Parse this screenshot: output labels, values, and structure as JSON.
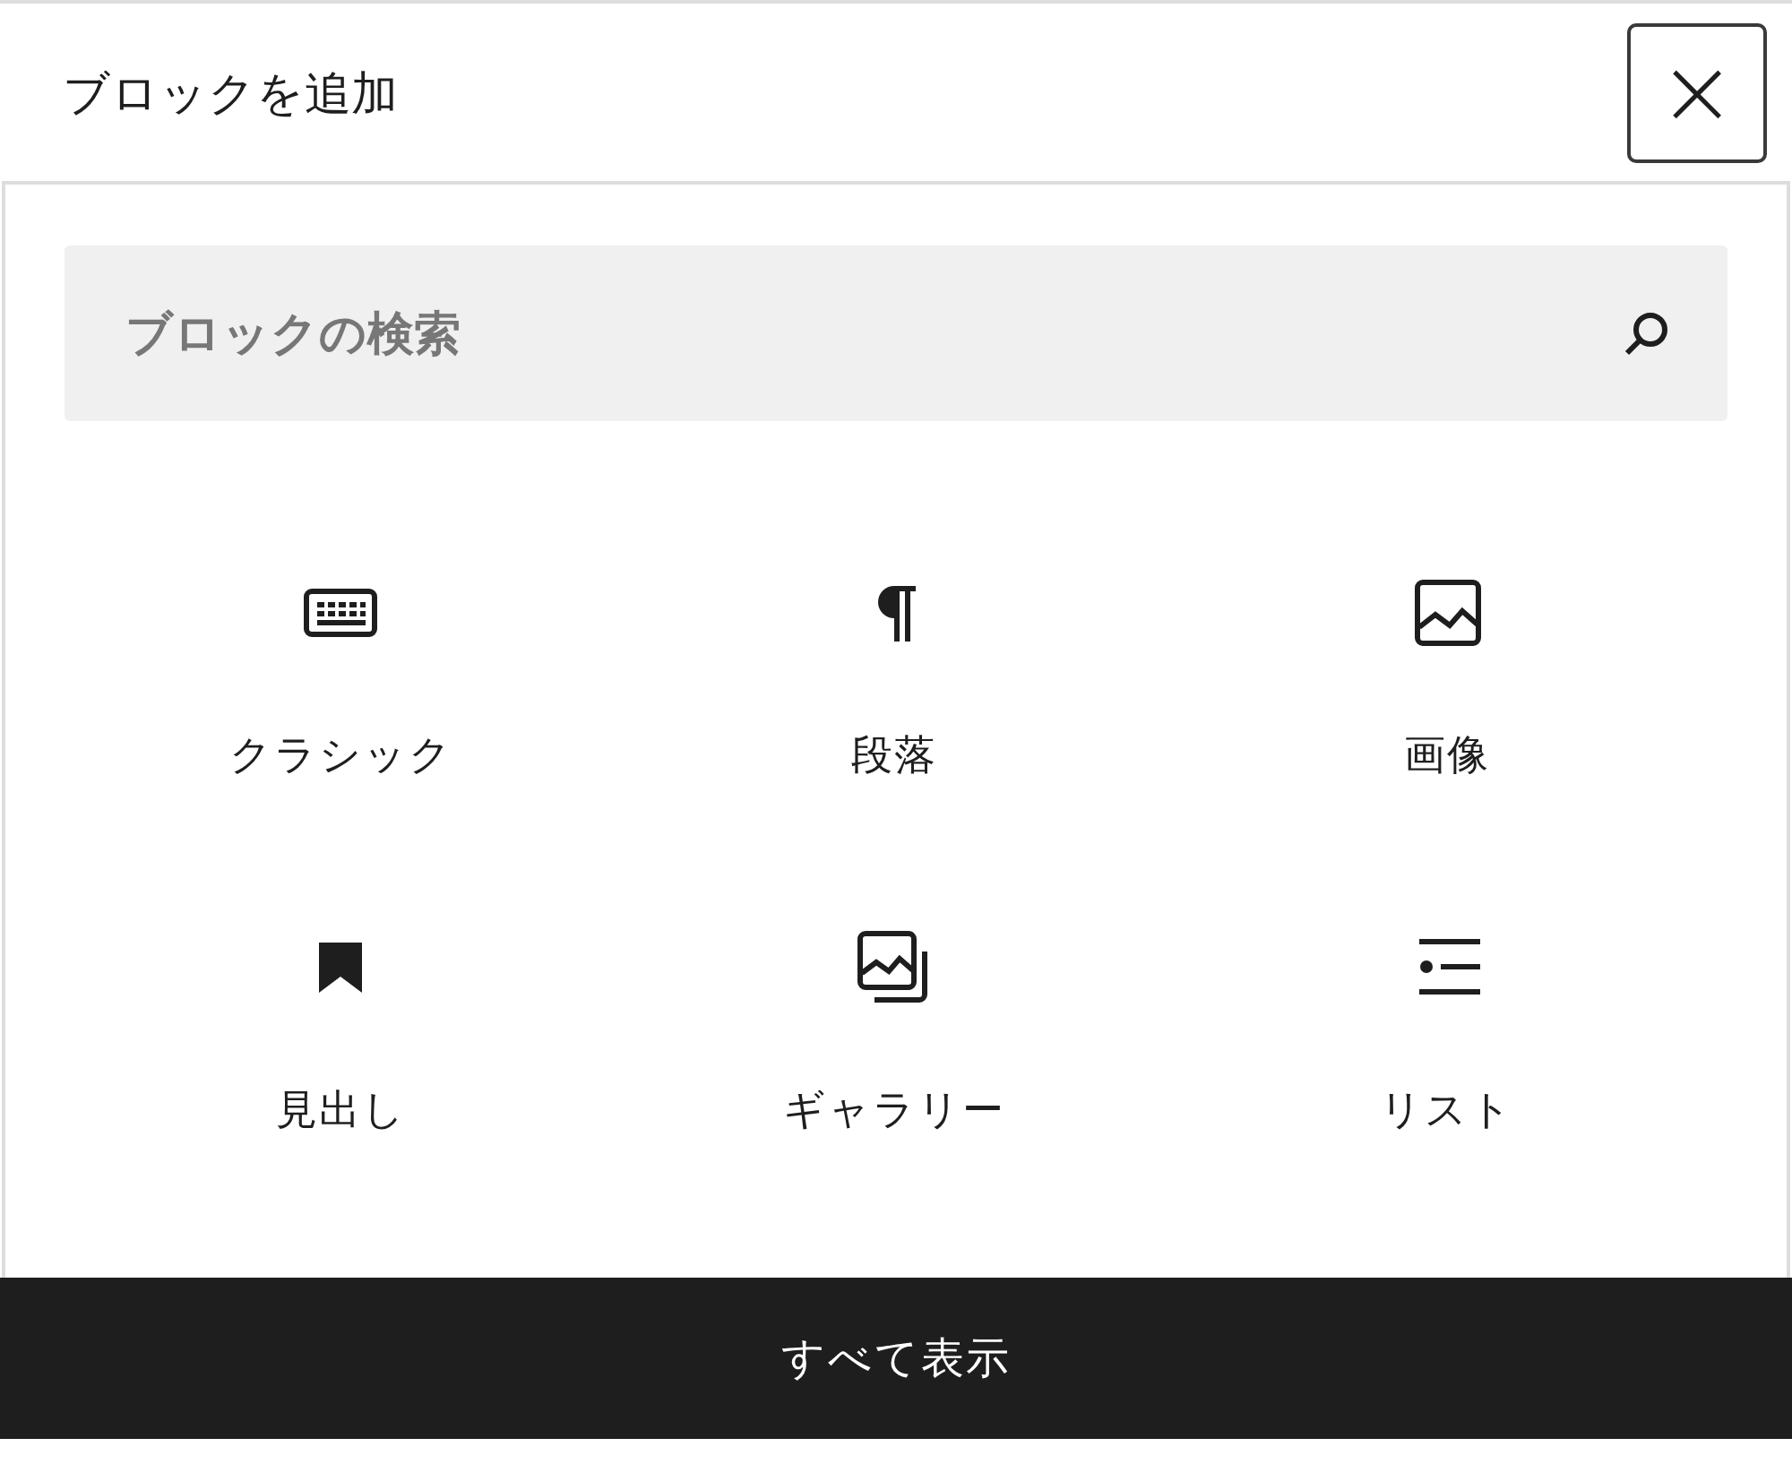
{
  "header": {
    "title": "ブロックを追加",
    "close": "×"
  },
  "search": {
    "placeholder": "ブロックの検索"
  },
  "blocks": [
    {
      "label": "クラシック",
      "kind": "keyboard"
    },
    {
      "label": "段落",
      "kind": "pilcrow"
    },
    {
      "label": "画像",
      "kind": "image"
    },
    {
      "label": "見出し",
      "kind": "bookmark"
    },
    {
      "label": "ギャラリー",
      "kind": "gallery"
    },
    {
      "label": "リスト",
      "kind": "list"
    }
  ],
  "footer": {
    "button": "すべて表示"
  }
}
